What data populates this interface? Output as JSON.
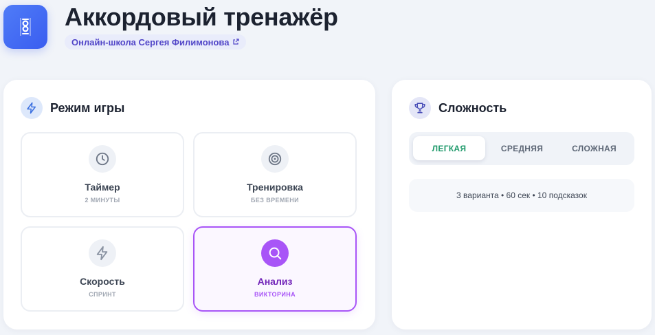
{
  "app": {
    "title": "Аккордовый тренажёр",
    "logo_icon": "guitar-fretboard-icon",
    "school_link": "Онлайн-школа Сергея Филимонова",
    "school_link_icon": "external-link-icon"
  },
  "mode_panel": {
    "title": "Режим игры",
    "icon": "lightning-icon",
    "modes": [
      {
        "name": "Таймер",
        "subtitle": "2 МИНУТЫ",
        "icon": "clock-icon",
        "selected": false
      },
      {
        "name": "Тренировка",
        "subtitle": "БЕЗ ВРЕМЕНИ",
        "icon": "target-icon",
        "selected": false
      },
      {
        "name": "Скорость",
        "subtitle": "СПРИНТ",
        "icon": "lightning-icon",
        "selected": false
      },
      {
        "name": "Анализ",
        "subtitle": "ВИКТОРИНА",
        "icon": "search-icon",
        "selected": true
      }
    ]
  },
  "difficulty_panel": {
    "title": "Сложность",
    "icon": "trophy-icon",
    "levels": [
      {
        "label": "ЛЕГКАЯ",
        "selected": true
      },
      {
        "label": "СРЕДНЯЯ",
        "selected": false
      },
      {
        "label": "СЛОЖНАЯ",
        "selected": false
      }
    ],
    "summary": "3 варианта • 60 сек • 10 подсказок"
  },
  "colors": {
    "accent_blue": "#3a5df0",
    "accent_purple": "#a855f7",
    "easy_green": "#1f9a6b",
    "background": "#f1f4f9"
  }
}
